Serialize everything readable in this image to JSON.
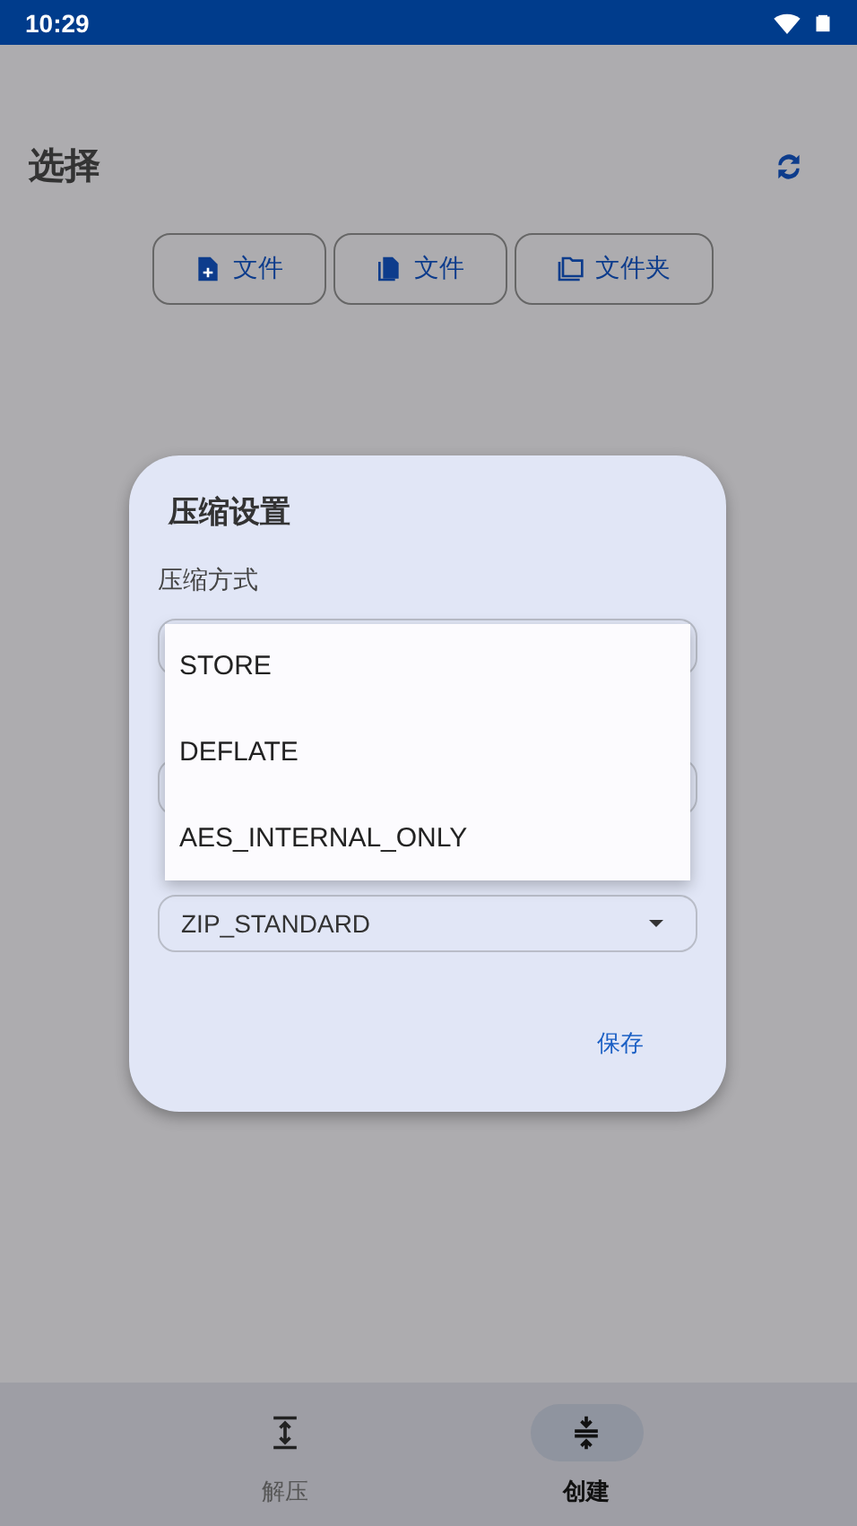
{
  "status_bar": {
    "time": "10:29"
  },
  "header": {
    "title": "选择"
  },
  "pick_buttons": [
    {
      "label": "文件",
      "kind": "file-add"
    },
    {
      "label": "文件",
      "kind": "files"
    },
    {
      "label": "文件夹",
      "kind": "folder"
    }
  ],
  "dialog": {
    "title": "压缩设置",
    "method_label": "压缩方式",
    "fields": [
      {
        "kind": "covered"
      },
      {
        "kind": "covered"
      },
      {
        "kind": "dropdown",
        "value": "ZIP_STANDARD"
      }
    ],
    "menu": [
      {
        "label": "STORE"
      },
      {
        "label": "DEFLATE"
      },
      {
        "label": "AES_INTERNAL_ONLY"
      }
    ],
    "save": "保存"
  },
  "bottom_nav": [
    {
      "label": "解压",
      "kind": "expand",
      "selected": false
    },
    {
      "label": "创建",
      "kind": "compress",
      "selected": true
    }
  ]
}
